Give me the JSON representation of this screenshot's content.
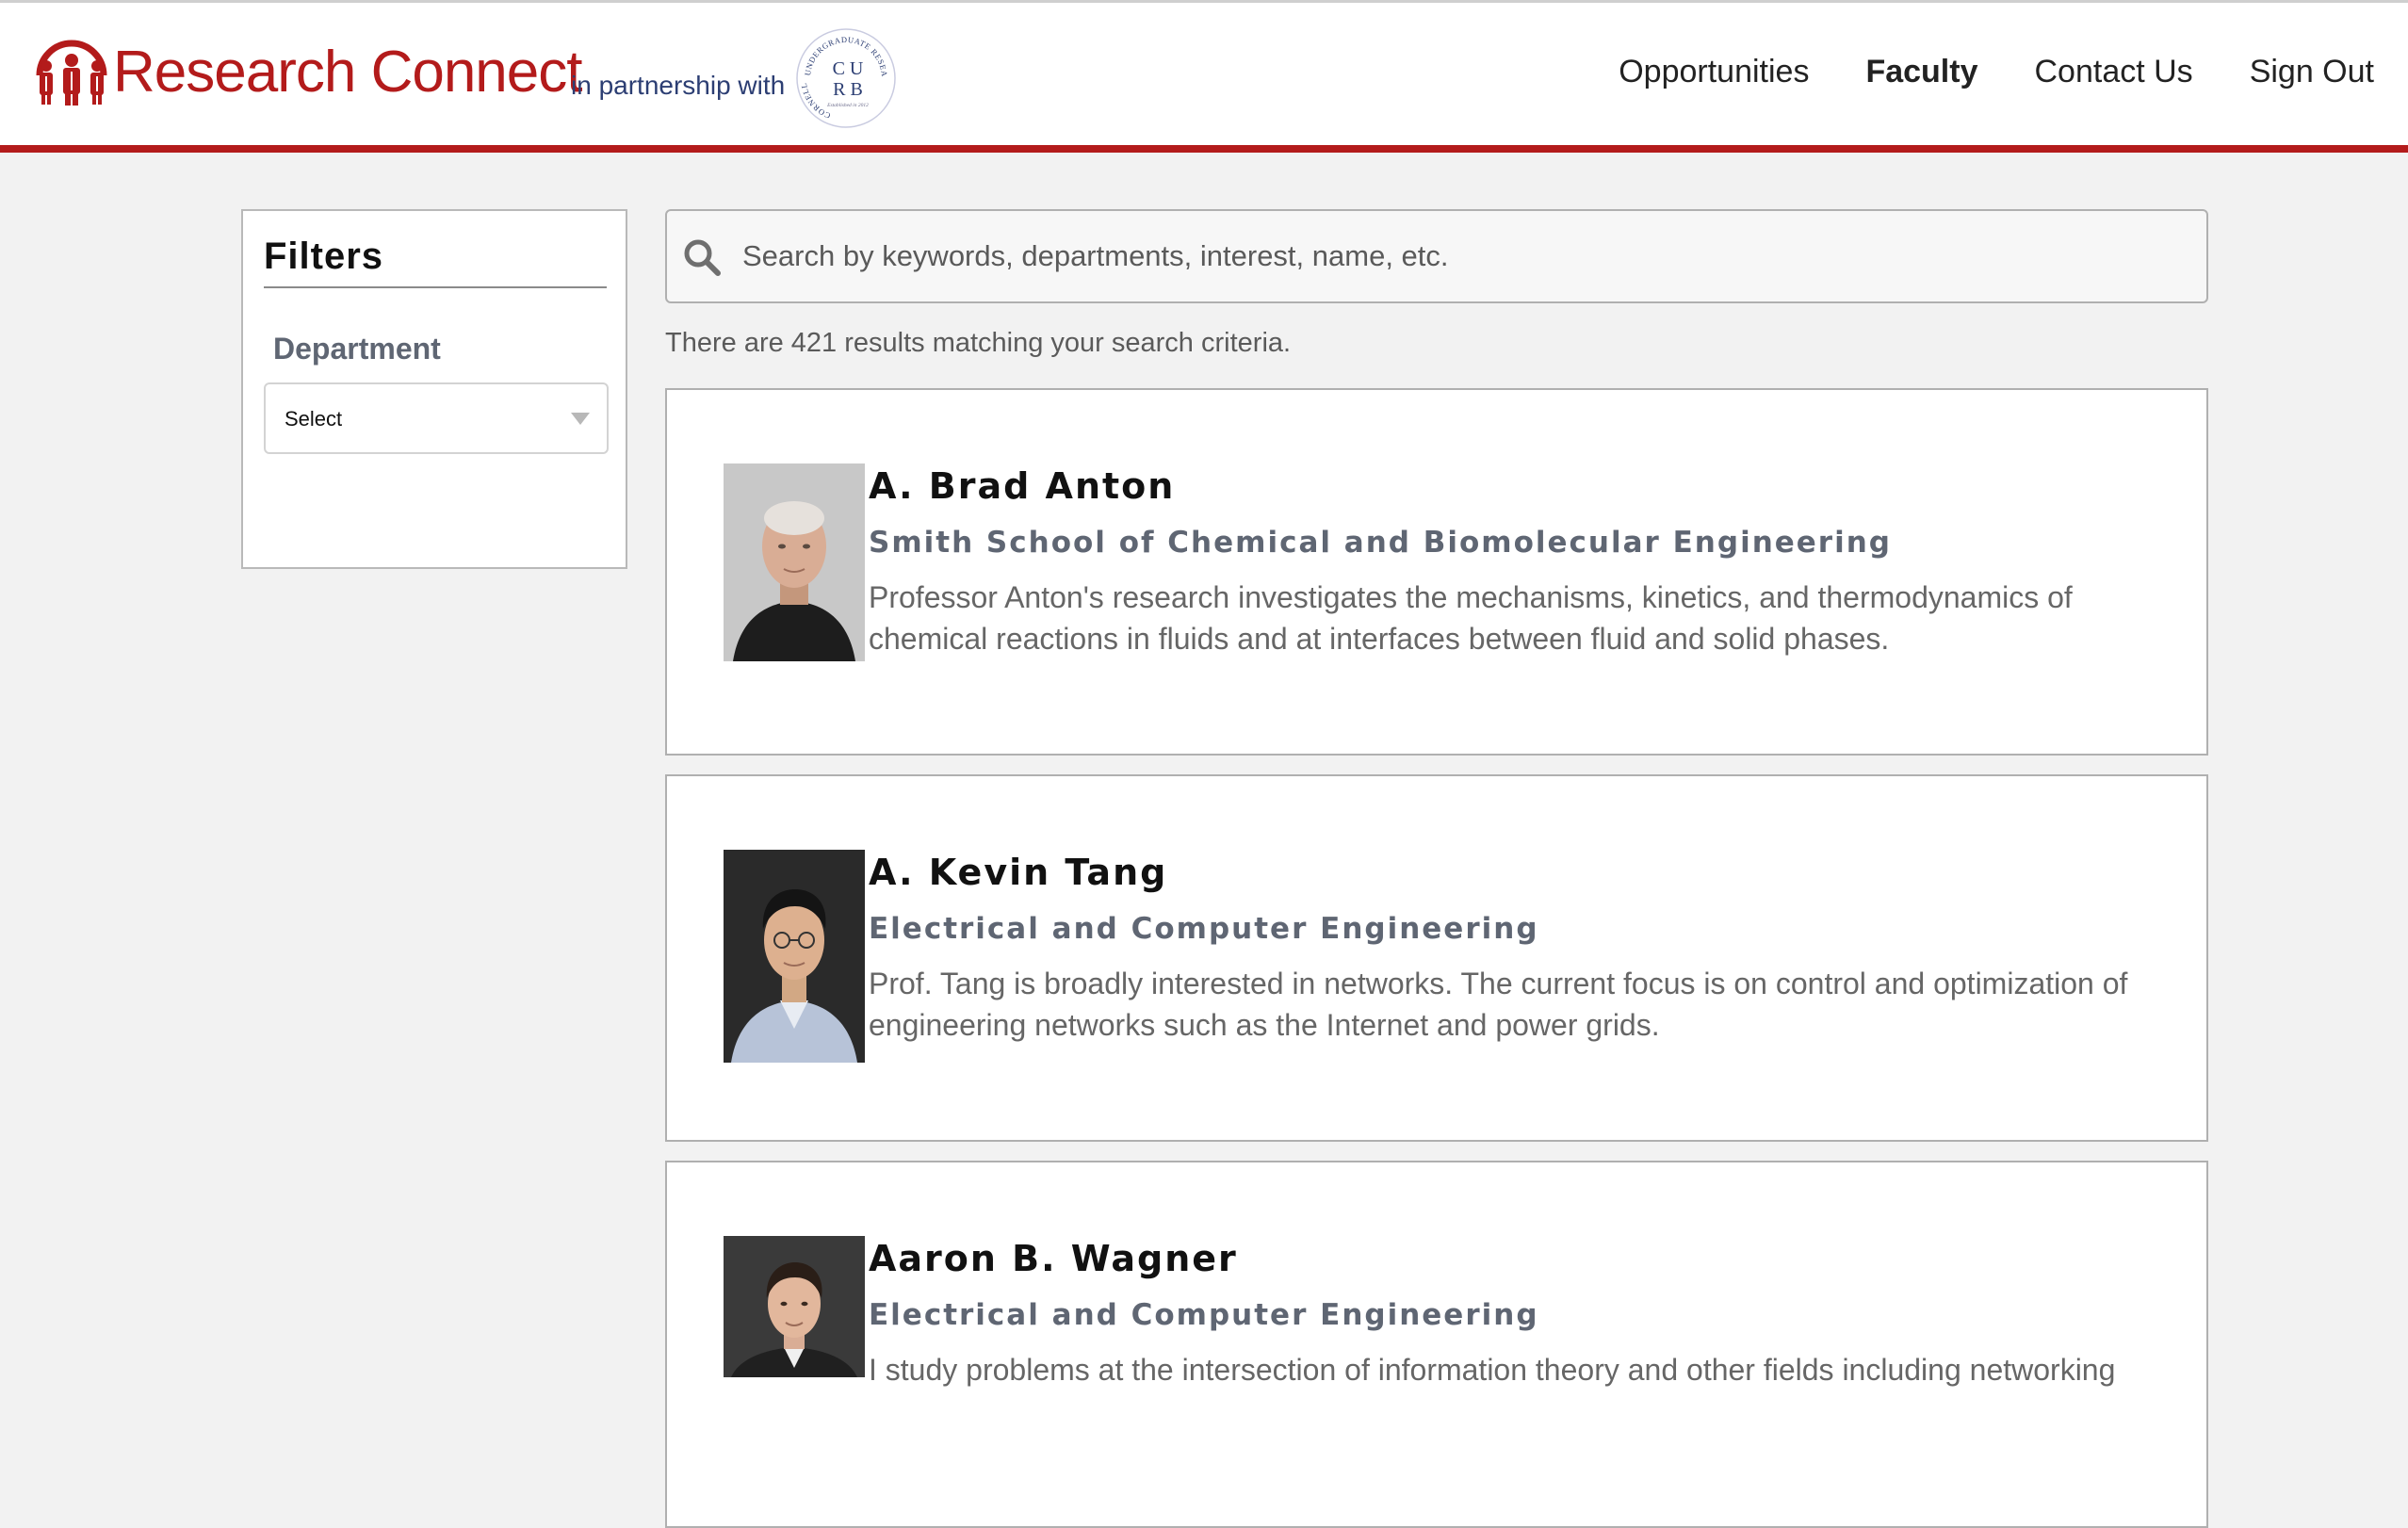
{
  "header": {
    "app_name": "Research Connect",
    "partner_text": "in partnership with",
    "seal": {
      "top_arc": "UNDERGRADUATE RESEARCH BOARD",
      "side_text": "CORNELL",
      "initials_line1": "C U",
      "initials_line2": "R B",
      "established": "Established in 2012"
    },
    "nav": [
      {
        "label": "Opportunities",
        "active": false
      },
      {
        "label": "Faculty",
        "active": true
      },
      {
        "label": "Contact Us",
        "active": false
      },
      {
        "label": "Sign Out",
        "active": false
      }
    ],
    "brand_color": "#b31b1b"
  },
  "filters": {
    "title": "Filters",
    "department_label": "Department",
    "department_select_value": "Select"
  },
  "search": {
    "placeholder": "Search by keywords, departments, interest, name, etc.",
    "value": ""
  },
  "results_text": "There are 421 results matching your search criteria.",
  "results": [
    {
      "name": "A. Brad Anton",
      "department": "Smith School of Chemical and Biomolecular Engineering",
      "description": "Professor Anton's research investigates the mechanisms, kinetics, and thermodynamics of chemical reactions in fluids and at interfaces between fluid and solid phases."
    },
    {
      "name": "A. Kevin Tang",
      "department": "Electrical and Computer Engineering",
      "description": "Prof. Tang is broadly interested in networks. The current focus is on control and optimization of engineering networks such as the Internet and power grids."
    },
    {
      "name": "Aaron B. Wagner",
      "department": "Electrical and Computer Engineering",
      "description": "I study problems at the intersection of information theory and other fields including networking"
    }
  ]
}
